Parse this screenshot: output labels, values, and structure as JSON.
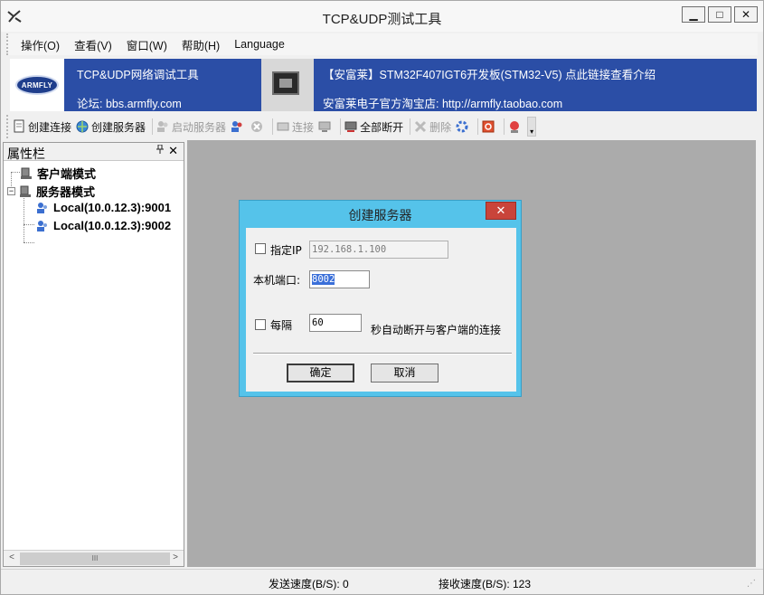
{
  "window": {
    "title": "TCP&UDP测试工具",
    "controls": {
      "minimize": "▁",
      "maximize": "□",
      "close": "✕"
    }
  },
  "menu": {
    "items": [
      "操作(O)",
      "查看(V)",
      "窗口(W)",
      "帮助(H)",
      "Language"
    ]
  },
  "banner": {
    "logo_text": "ARMFLY",
    "left_line1": "TCP&UDP网络调试工具",
    "left_line2": "论坛: bbs.armfly.com",
    "right_line1": "【安富莱】STM32F407IGT6开发板(STM32-V5) 点此链接查看介绍",
    "right_line2": "安富莱电子官方淘宝店: http://armfly.taobao.com"
  },
  "toolbar": {
    "create_connection": "创建连接",
    "create_server": "创建服务器",
    "start_server": "启动服务器",
    "connect": "连接",
    "disconnect_all": "全部断开",
    "delete": "删除"
  },
  "panel": {
    "title": "属性栏",
    "pin": "ㅁ",
    "close": "✕",
    "tree": {
      "client_mode": "客户端模式",
      "server_mode": "服务器模式",
      "server_children": [
        "Local(10.0.12.3):9001",
        "Local(10.0.12.3):9002"
      ]
    },
    "scroll_thumb": "III"
  },
  "status": {
    "send_speed": "发送速度(B/S): 0",
    "recv_speed": "接收速度(B/S): 123"
  },
  "dialog": {
    "title": "创建服务器",
    "close": "✕",
    "specify_ip_label": "指定IP",
    "specify_ip_value": "192.168.1.100",
    "local_port_label": "本机端口:",
    "local_port_value": "8002",
    "every_label": "每隔",
    "every_value": "60",
    "every_suffix": "秒自动断开与客户端的连接",
    "ok": "确定",
    "cancel": "取消"
  },
  "colors": {
    "banner_bg": "#2b4ea6",
    "dialog_frame": "#55c3ea",
    "close_red": "#c9443a",
    "main_area_bg": "#ababab"
  }
}
